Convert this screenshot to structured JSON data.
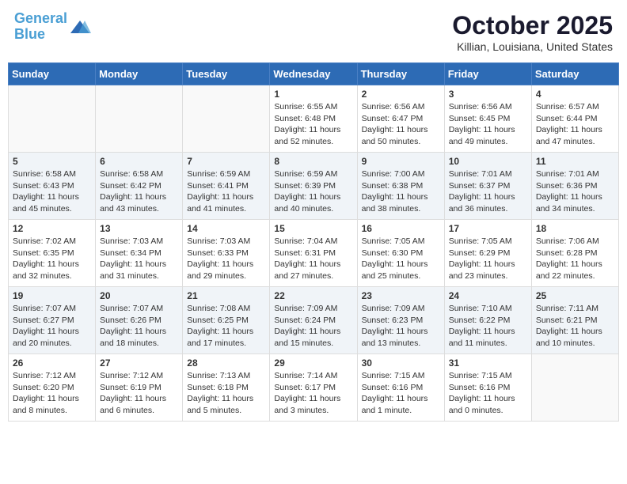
{
  "header": {
    "logo_line1": "General",
    "logo_line2": "Blue",
    "month": "October 2025",
    "location": "Killian, Louisiana, United States"
  },
  "days_of_week": [
    "Sunday",
    "Monday",
    "Tuesday",
    "Wednesday",
    "Thursday",
    "Friday",
    "Saturday"
  ],
  "weeks": [
    [
      {
        "day": "",
        "info": ""
      },
      {
        "day": "",
        "info": ""
      },
      {
        "day": "",
        "info": ""
      },
      {
        "day": "1",
        "info": "Sunrise: 6:55 AM\nSunset: 6:48 PM\nDaylight: 11 hours\nand 52 minutes."
      },
      {
        "day": "2",
        "info": "Sunrise: 6:56 AM\nSunset: 6:47 PM\nDaylight: 11 hours\nand 50 minutes."
      },
      {
        "day": "3",
        "info": "Sunrise: 6:56 AM\nSunset: 6:45 PM\nDaylight: 11 hours\nand 49 minutes."
      },
      {
        "day": "4",
        "info": "Sunrise: 6:57 AM\nSunset: 6:44 PM\nDaylight: 11 hours\nand 47 minutes."
      }
    ],
    [
      {
        "day": "5",
        "info": "Sunrise: 6:58 AM\nSunset: 6:43 PM\nDaylight: 11 hours\nand 45 minutes."
      },
      {
        "day": "6",
        "info": "Sunrise: 6:58 AM\nSunset: 6:42 PM\nDaylight: 11 hours\nand 43 minutes."
      },
      {
        "day": "7",
        "info": "Sunrise: 6:59 AM\nSunset: 6:41 PM\nDaylight: 11 hours\nand 41 minutes."
      },
      {
        "day": "8",
        "info": "Sunrise: 6:59 AM\nSunset: 6:39 PM\nDaylight: 11 hours\nand 40 minutes."
      },
      {
        "day": "9",
        "info": "Sunrise: 7:00 AM\nSunset: 6:38 PM\nDaylight: 11 hours\nand 38 minutes."
      },
      {
        "day": "10",
        "info": "Sunrise: 7:01 AM\nSunset: 6:37 PM\nDaylight: 11 hours\nand 36 minutes."
      },
      {
        "day": "11",
        "info": "Sunrise: 7:01 AM\nSunset: 6:36 PM\nDaylight: 11 hours\nand 34 minutes."
      }
    ],
    [
      {
        "day": "12",
        "info": "Sunrise: 7:02 AM\nSunset: 6:35 PM\nDaylight: 11 hours\nand 32 minutes."
      },
      {
        "day": "13",
        "info": "Sunrise: 7:03 AM\nSunset: 6:34 PM\nDaylight: 11 hours\nand 31 minutes."
      },
      {
        "day": "14",
        "info": "Sunrise: 7:03 AM\nSunset: 6:33 PM\nDaylight: 11 hours\nand 29 minutes."
      },
      {
        "day": "15",
        "info": "Sunrise: 7:04 AM\nSunset: 6:31 PM\nDaylight: 11 hours\nand 27 minutes."
      },
      {
        "day": "16",
        "info": "Sunrise: 7:05 AM\nSunset: 6:30 PM\nDaylight: 11 hours\nand 25 minutes."
      },
      {
        "day": "17",
        "info": "Sunrise: 7:05 AM\nSunset: 6:29 PM\nDaylight: 11 hours\nand 23 minutes."
      },
      {
        "day": "18",
        "info": "Sunrise: 7:06 AM\nSunset: 6:28 PM\nDaylight: 11 hours\nand 22 minutes."
      }
    ],
    [
      {
        "day": "19",
        "info": "Sunrise: 7:07 AM\nSunset: 6:27 PM\nDaylight: 11 hours\nand 20 minutes."
      },
      {
        "day": "20",
        "info": "Sunrise: 7:07 AM\nSunset: 6:26 PM\nDaylight: 11 hours\nand 18 minutes."
      },
      {
        "day": "21",
        "info": "Sunrise: 7:08 AM\nSunset: 6:25 PM\nDaylight: 11 hours\nand 17 minutes."
      },
      {
        "day": "22",
        "info": "Sunrise: 7:09 AM\nSunset: 6:24 PM\nDaylight: 11 hours\nand 15 minutes."
      },
      {
        "day": "23",
        "info": "Sunrise: 7:09 AM\nSunset: 6:23 PM\nDaylight: 11 hours\nand 13 minutes."
      },
      {
        "day": "24",
        "info": "Sunrise: 7:10 AM\nSunset: 6:22 PM\nDaylight: 11 hours\nand 11 minutes."
      },
      {
        "day": "25",
        "info": "Sunrise: 7:11 AM\nSunset: 6:21 PM\nDaylight: 11 hours\nand 10 minutes."
      }
    ],
    [
      {
        "day": "26",
        "info": "Sunrise: 7:12 AM\nSunset: 6:20 PM\nDaylight: 11 hours\nand 8 minutes."
      },
      {
        "day": "27",
        "info": "Sunrise: 7:12 AM\nSunset: 6:19 PM\nDaylight: 11 hours\nand 6 minutes."
      },
      {
        "day": "28",
        "info": "Sunrise: 7:13 AM\nSunset: 6:18 PM\nDaylight: 11 hours\nand 5 minutes."
      },
      {
        "day": "29",
        "info": "Sunrise: 7:14 AM\nSunset: 6:17 PM\nDaylight: 11 hours\nand 3 minutes."
      },
      {
        "day": "30",
        "info": "Sunrise: 7:15 AM\nSunset: 6:16 PM\nDaylight: 11 hours\nand 1 minute."
      },
      {
        "day": "31",
        "info": "Sunrise: 7:15 AM\nSunset: 6:16 PM\nDaylight: 11 hours\nand 0 minutes."
      },
      {
        "day": "",
        "info": ""
      }
    ]
  ]
}
